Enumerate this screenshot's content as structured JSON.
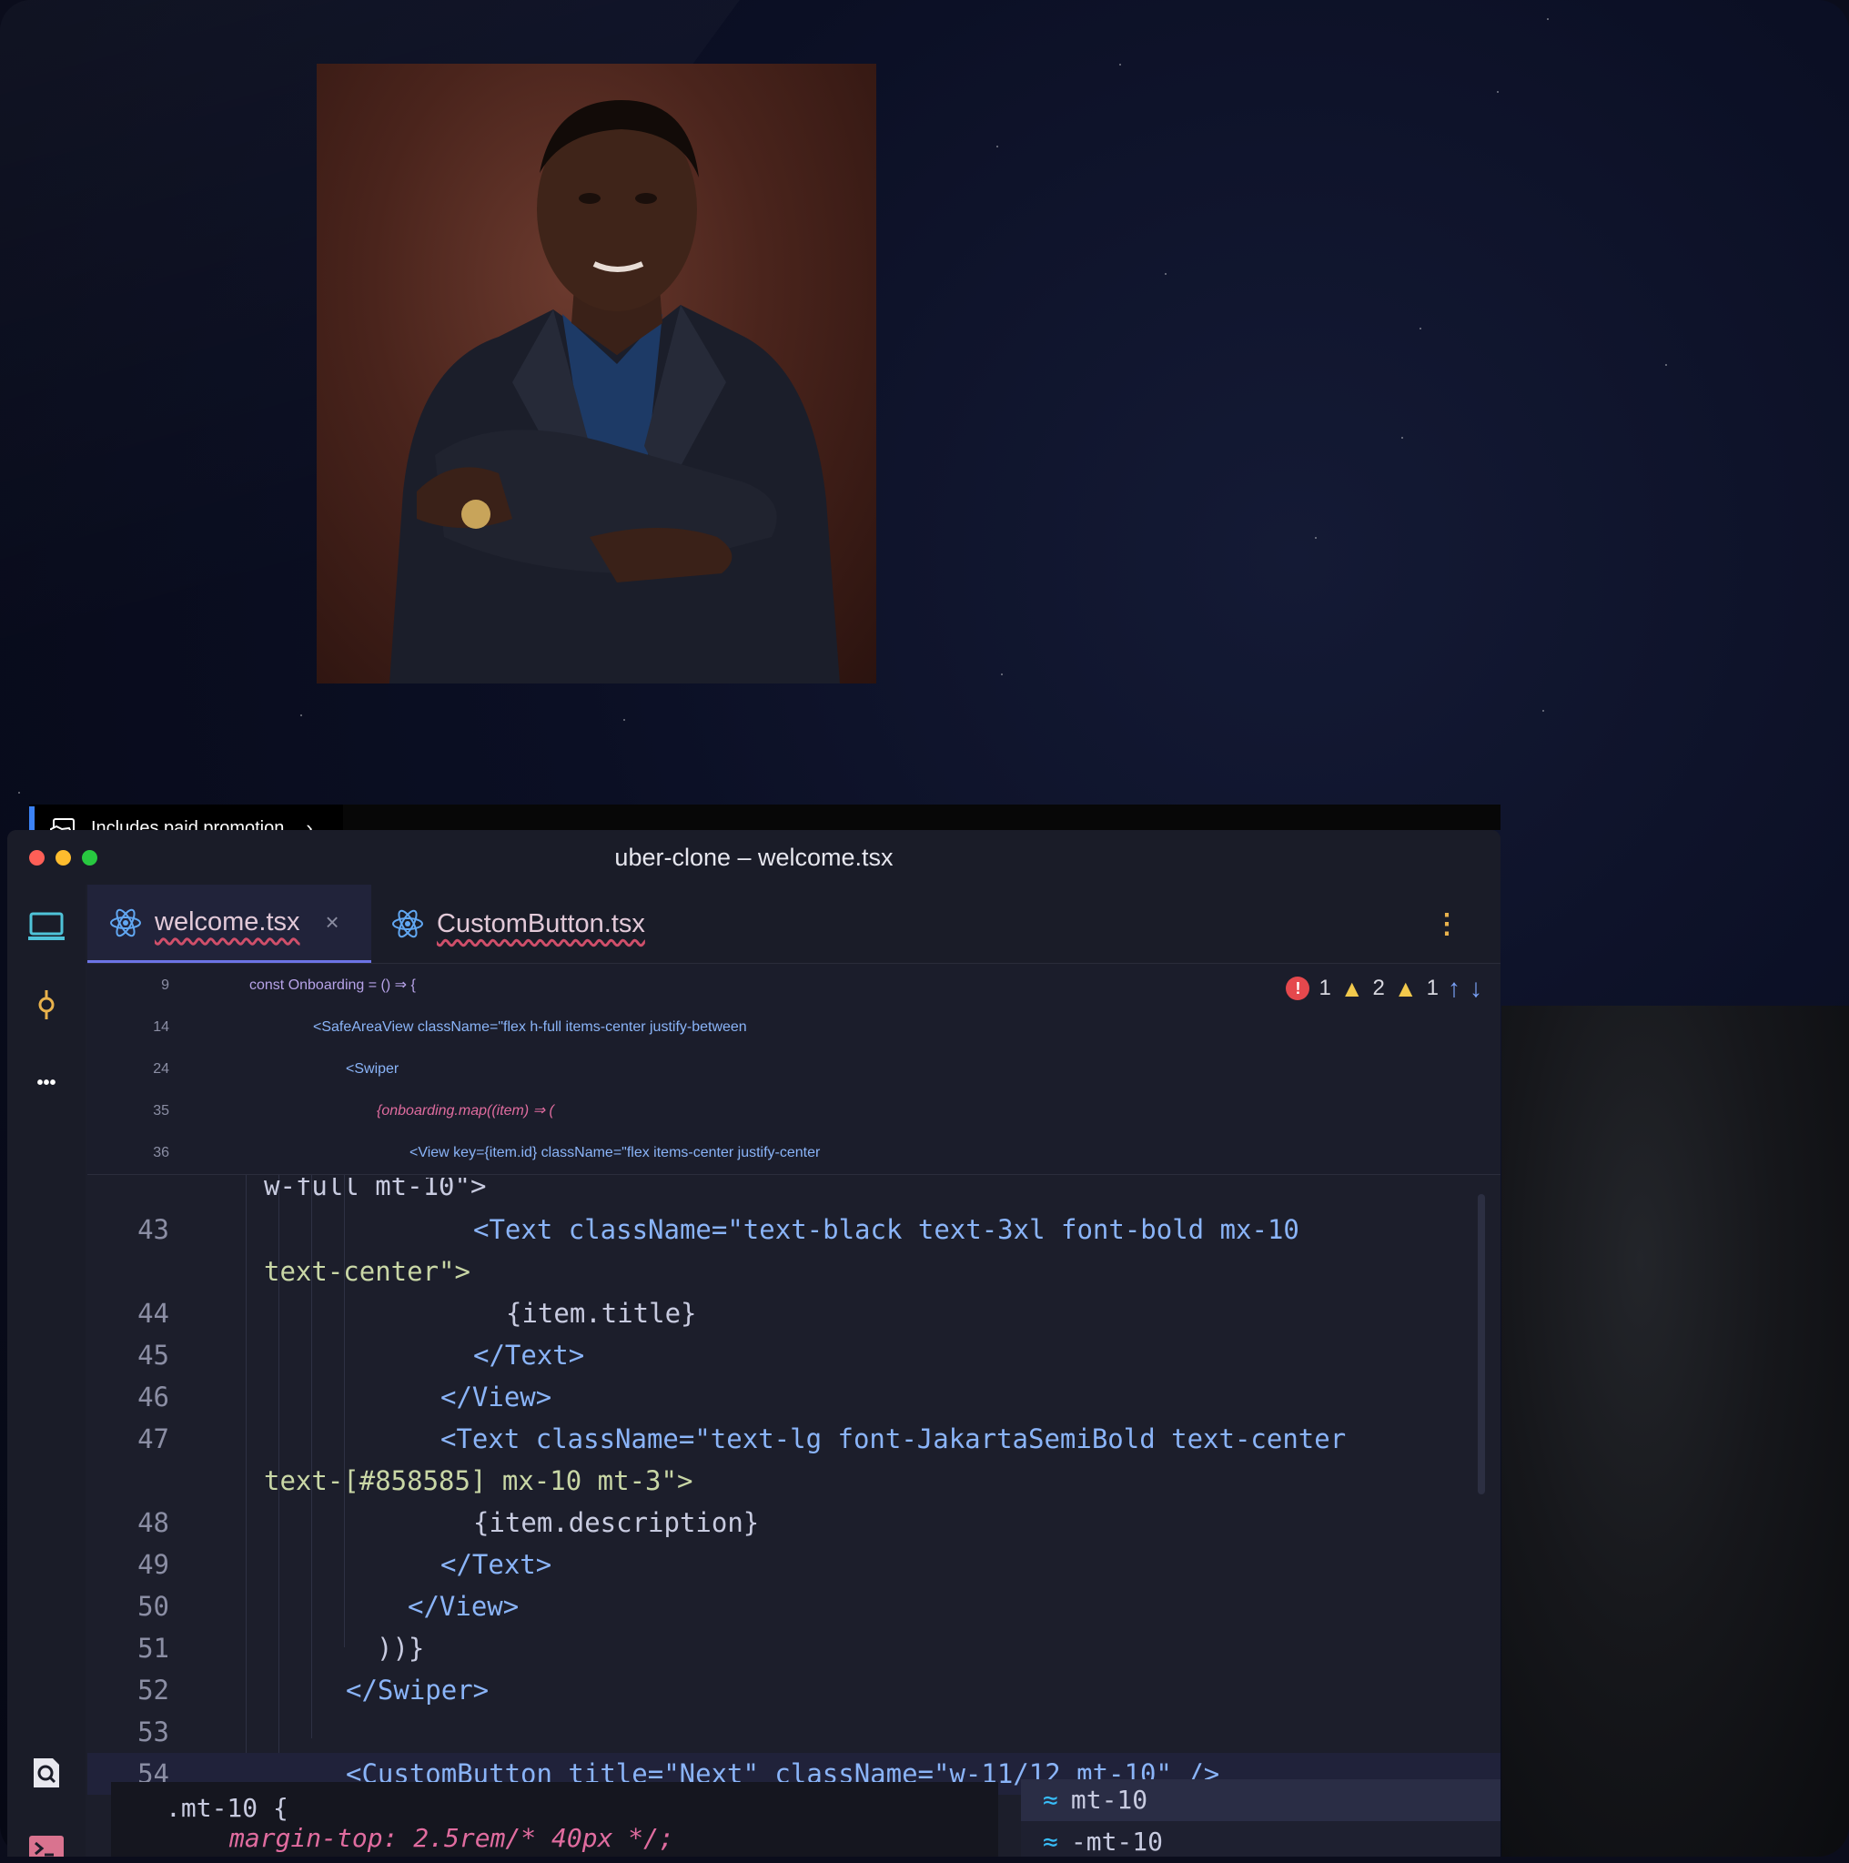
{
  "promo": {
    "label": "Includes paid promotion",
    "chevron": "›"
  },
  "window": {
    "title": "uber-clone – welcome.tsx"
  },
  "sidebar": {
    "icons": [
      "monitor-icon",
      "git-commit-icon",
      "more-icon",
      "search-icon",
      "terminal-icon"
    ],
    "more_glyph": "•••"
  },
  "tabs": [
    {
      "label": "welcome.tsx",
      "active": true,
      "close": "×"
    },
    {
      "label": "CustomButton.tsx",
      "active": false
    }
  ],
  "menu_glyph": "⋮",
  "status": {
    "errors": "1",
    "warnings": "2",
    "weak_warnings": "1"
  },
  "sticky_lines": [
    {
      "n": "9",
      "text": "const Onboarding = () ⇒ {"
    },
    {
      "n": "14",
      "text": "<SafeAreaView className=\"flex h-full items-center justify-between"
    },
    {
      "n": "24",
      "text": "<Swiper"
    },
    {
      "n": "35",
      "text": "{onboarding.map((item) ⇒ ("
    },
    {
      "n": "36",
      "text": "<View key={item.id} className=\"flex items-center justify-center"
    }
  ],
  "clipped_line": "w-full mt-10\">",
  "lines": [
    {
      "n": "43",
      "text": "<Text className=\"text-black text-3xl font-bold mx-10"
    },
    {
      "n": "",
      "text": "text-center\">"
    },
    {
      "n": "44",
      "text": "{item.title}"
    },
    {
      "n": "45",
      "text": "</Text>"
    },
    {
      "n": "46",
      "text": "</View>"
    },
    {
      "n": "47",
      "text": "<Text className=\"text-lg font-JakartaSemiBold text-center"
    },
    {
      "n": "",
      "text": "text-[#858585] mx-10 mt-3\">"
    },
    {
      "n": "48",
      "text": "{item.description}"
    },
    {
      "n": "49",
      "text": "</Text>"
    },
    {
      "n": "50",
      "text": "</View>"
    },
    {
      "n": "51",
      "text": "))}"
    },
    {
      "n": "52",
      "text": "</Swiper>"
    },
    {
      "n": "53",
      "text": ""
    },
    {
      "n": "54",
      "text": "<CustomButton title=\"Next\" className=\"w-11/12 mt-10\" />"
    }
  ],
  "doc_popup": {
    "line1": ".mt-10 {",
    "line2": "margin-top: 2.5rem/* 40px */;"
  },
  "completion": {
    "items": [
      "mt-10",
      "-mt-10"
    ]
  },
  "colors": {
    "accent": "#6c74e6",
    "tag": "#8ab4f8",
    "string": "#c9d7a6",
    "italic": "#e06c9f",
    "error": "#e5484d",
    "warning": "#f2c94c"
  }
}
